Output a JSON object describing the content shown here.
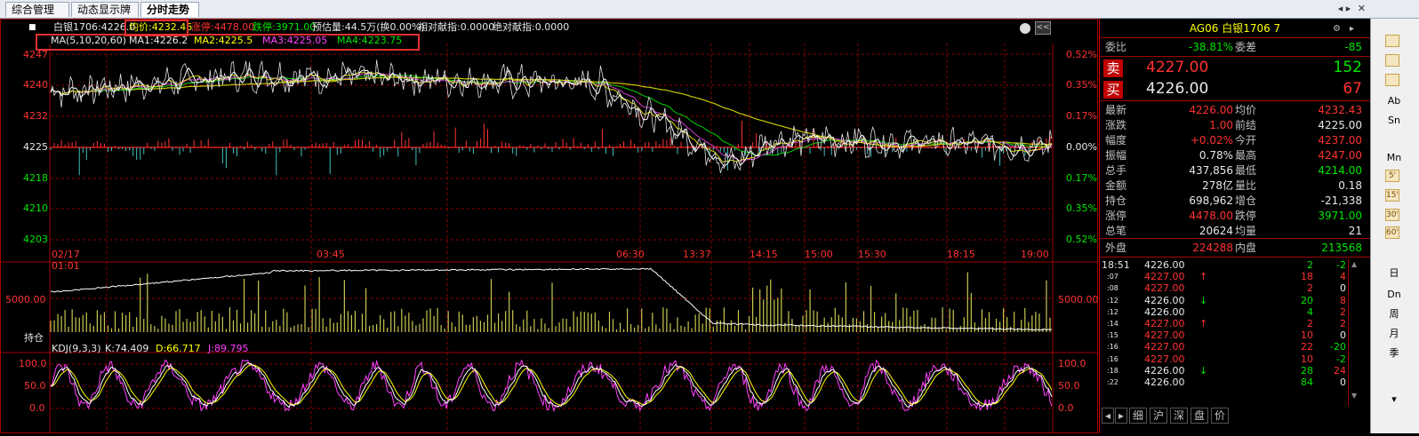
{
  "tabs": [
    "综合管理",
    "动态显示牌",
    "分时走势"
  ],
  "header": {
    "price_label": "白银1706:4226.0",
    "avg_label": "均价:4232.46",
    "limit_up_label": "涨停:4478.00",
    "limit_down_label": "跌停:3971.00",
    "est_label": "预估量:44.5万(换0.00%)",
    "rel_index_label": "相对献指:0.0000",
    "abs_index_label": "绝对献指:0.0000",
    "collapse_label": "<<"
  },
  "ma": {
    "title": "MA(5,10,20,60)",
    "ma1": "MA1:4226.2",
    "ma2": "MA2:4225.5",
    "ma3": "MA3:4225.05",
    "ma4": "MA4:4223.75"
  },
  "price_axis_left": [
    "4247",
    "4240",
    "4232",
    "4225",
    "4218",
    "4210",
    "4203"
  ],
  "price_axis_right": [
    "0.52%",
    "0.35%",
    "0.17%",
    "0.00%",
    "0.17%",
    "0.35%",
    "0.52%"
  ],
  "time_axis": [
    "02/17 01:01",
    "03:45",
    "06:30",
    "13:37",
    "14:15",
    "15:00",
    "15:30",
    "18:15",
    "19:00"
  ],
  "volume": {
    "left_tick": "5000.00",
    "right_tick": "5000.00",
    "label": "持仓"
  },
  "kdj": {
    "title": "KDJ(9,3,3)",
    "k": "K:74.409",
    "d": "D:66.717",
    "j": "J:89.795",
    "left_ticks": [
      "100.0",
      "50.0",
      "0.0"
    ],
    "right_ticks": [
      "100.0",
      "50.0",
      "0.0"
    ]
  },
  "quote": {
    "title": "AG06  白银1706  7",
    "weibi_label": "委比",
    "weibi": "-38.81%",
    "weicha_label": "委差",
    "weicha": "-85",
    "sell_label": "卖",
    "sell_price": "4227.00",
    "sell_qty": "152",
    "buy_label": "买",
    "buy_price": "4226.00",
    "buy_qty": "67",
    "rows": [
      {
        "l1": "最新",
        "v1": "4226.00",
        "c1": "red",
        "l2": "均价",
        "v2": "4232.43",
        "c2": "red"
      },
      {
        "l1": "涨跌",
        "v1": "1.00",
        "c1": "red",
        "l2": "前结",
        "v2": "4225.00",
        "c2": "wht"
      },
      {
        "l1": "幅度",
        "v1": "+0.02%",
        "c1": "red",
        "l2": "今开",
        "v2": "4237.00",
        "c2": "red"
      },
      {
        "l1": "振幅",
        "v1": "0.78%",
        "c1": "wht",
        "l2": "最高",
        "v2": "4247.00",
        "c2": "red"
      },
      {
        "l1": "总手",
        "v1": "437,856",
        "c1": "wht",
        "l2": "最低",
        "v2": "4214.00",
        "c2": "grn"
      },
      {
        "l1": "金额",
        "v1": "278亿",
        "c1": "wht",
        "l2": "量比",
        "v2": "0.18",
        "c2": "wht"
      },
      {
        "l1": "持仓",
        "v1": "698,962",
        "c1": "wht",
        "l2": "增仓",
        "v2": "-21,338",
        "c2": "wht"
      },
      {
        "l1": "涨停",
        "v1": "4478.00",
        "c1": "red",
        "l2": "跌停",
        "v2": "3971.00",
        "c2": "grn"
      },
      {
        "l1": "总笔",
        "v1": "20624",
        "c1": "wht",
        "l2": "均量",
        "v2": "21",
        "c2": "wht"
      }
    ],
    "outer_label": "外盘",
    "outer": "224288",
    "inner_label": "内盘",
    "inner": "213568"
  },
  "ticks": [
    {
      "t": "18:51",
      "p": "4226.00",
      "pc": "wht",
      "arr": "",
      "q": "2",
      "qc": "grn",
      "d": "-2",
      "dc": "grn"
    },
    {
      "t": ":07",
      "p": "4227.00",
      "pc": "red",
      "arr": "↑",
      "ac": "red",
      "q": "18",
      "qc": "red",
      "d": "4",
      "dc": "red"
    },
    {
      "t": ":08",
      "p": "4227.00",
      "pc": "red",
      "arr": "",
      "q": "2",
      "qc": "red",
      "d": "0",
      "dc": "wht"
    },
    {
      "t": ":12",
      "p": "4226.00",
      "pc": "wht",
      "arr": "↓",
      "ac": "grn",
      "q": "20",
      "qc": "grn",
      "d": "8",
      "dc": "red"
    },
    {
      "t": ":12",
      "p": "4226.00",
      "pc": "wht",
      "arr": "",
      "q": "4",
      "qc": "grn",
      "d": "2",
      "dc": "red"
    },
    {
      "t": ":14",
      "p": "4227.00",
      "pc": "red",
      "arr": "↑",
      "ac": "red",
      "q": "2",
      "qc": "red",
      "d": "2",
      "dc": "red"
    },
    {
      "t": ":15",
      "p": "4227.00",
      "pc": "red",
      "arr": "",
      "q": "10",
      "qc": "red",
      "d": "0",
      "dc": "wht"
    },
    {
      "t": ":16",
      "p": "4227.00",
      "pc": "red",
      "arr": "",
      "q": "22",
      "qc": "red",
      "d": "-20",
      "dc": "grn"
    },
    {
      "t": ":16",
      "p": "4227.00",
      "pc": "red",
      "arr": "",
      "q": "10",
      "qc": "red",
      "d": "-2",
      "dc": "grn"
    },
    {
      "t": ":18",
      "p": "4226.00",
      "pc": "wht",
      "arr": "↓",
      "ac": "grn",
      "q": "28",
      "qc": "grn",
      "d": "24",
      "dc": "red"
    },
    {
      "t": ":22",
      "p": "4226.00",
      "pc": "wht",
      "arr": "",
      "q": "84",
      "qc": "grn",
      "d": "0",
      "dc": "wht"
    }
  ],
  "bottom_tabs": [
    "细",
    "沪",
    "深",
    "盘",
    "价"
  ],
  "toolbar": [
    "Ab",
    "Sn",
    "Mn",
    "5'",
    "15'",
    "30'",
    "60'",
    "日",
    "Dn",
    "周",
    "月",
    "季"
  ],
  "colors": {
    "up": "#ff3232",
    "down": "#00e600",
    "grid": "#8b0000",
    "price_line": "#ffffff",
    "avg_line": "#ffff00"
  }
}
